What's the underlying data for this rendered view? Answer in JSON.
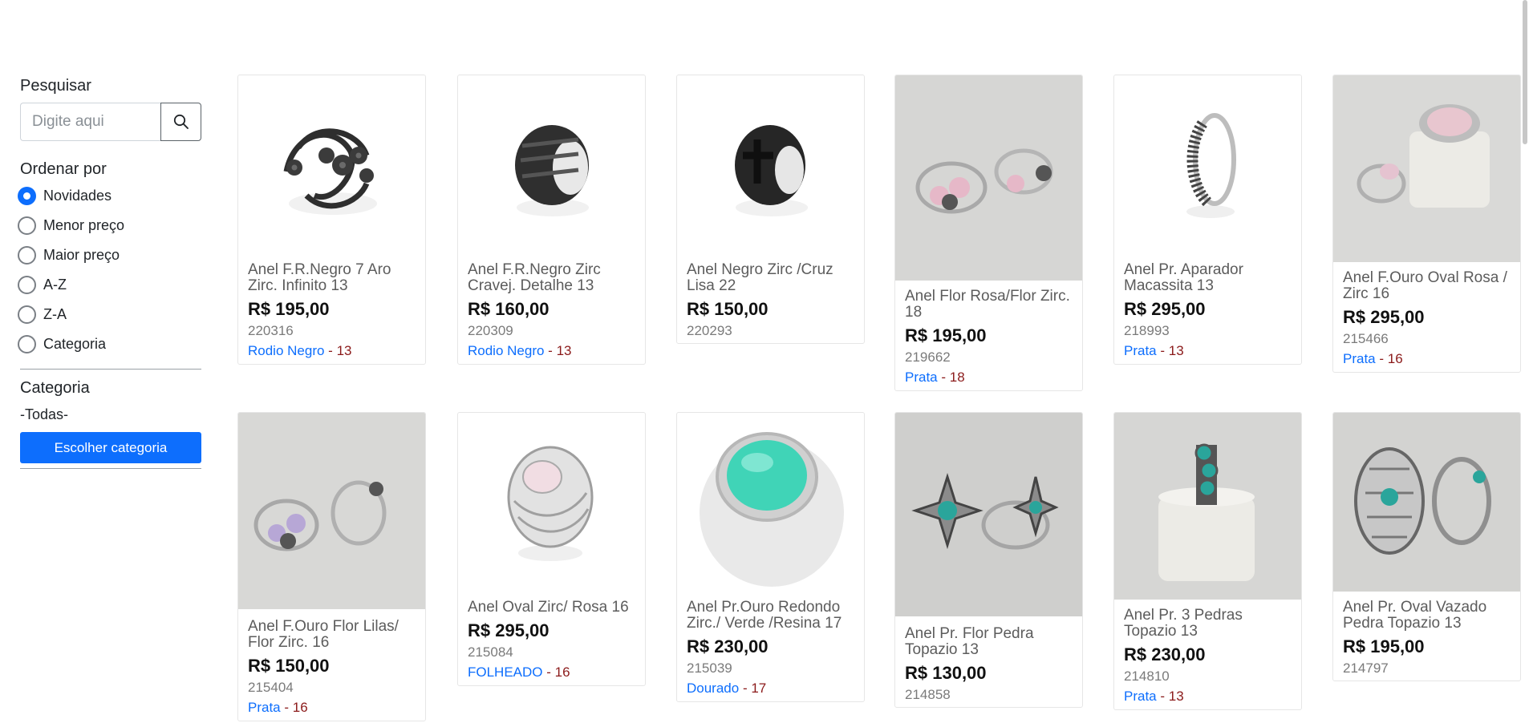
{
  "search": {
    "label": "Pesquisar",
    "placeholder": "Digite aqui"
  },
  "sort": {
    "title": "Ordenar por",
    "options": [
      "Novidades",
      "Menor preço",
      "Maior preço",
      "A-Z",
      "Z-A",
      "Categoria"
    ],
    "selected": "Novidades"
  },
  "category": {
    "title": "Categoria",
    "value": "-Todas-",
    "button_label": "Escolher categoria"
  },
  "colors": {
    "accent": "#0d6efd",
    "size_text": "#8b1a1a"
  },
  "products": [
    {
      "name": "Anel F.R.Negro 7 Aro Zirc. Infinito 13",
      "price": "R$ 195,00",
      "code": "220316",
      "metal": "Rodio Negro",
      "size": "13",
      "image": "black-ring-infinity"
    },
    {
      "name": "Anel F.R.Negro Zirc Cravej. Detalhe 13",
      "price": "R$ 160,00",
      "code": "220309",
      "metal": "Rodio Negro",
      "size": "13",
      "image": "black-ring-band"
    },
    {
      "name": "Anel Negro Zirc /Cruz Lisa 22",
      "price": "R$ 150,00",
      "code": "220293",
      "metal": "",
      "size": "",
      "image": "black-ring-cross"
    },
    {
      "name": "Anel Flor Rosa/Flor Zirc. 18",
      "price": "R$ 195,00",
      "code": "219662",
      "metal": "Prata",
      "size": "18",
      "image": "silver-flower-rings-photo"
    },
    {
      "name": "Anel Pr. Aparador Macassita 13",
      "price": "R$ 295,00",
      "code": "218993",
      "metal": "Prata",
      "size": "13",
      "image": "silver-marcasite-ring"
    },
    {
      "name": "Anel F.Ouro Oval Rosa / Zirc 16",
      "price": "R$ 295,00",
      "code": "215466",
      "metal": "Prata",
      "size": "16",
      "image": "pink-oval-ring-photo"
    },
    {
      "name": "Anel F.Ouro Flor Lilas/ Flor Zirc. 16",
      "price": "R$ 150,00",
      "code": "215404",
      "metal": "Prata",
      "size": "16",
      "image": "lilac-flower-rings-photo"
    },
    {
      "name": "Anel Oval Zirc/ Rosa 16",
      "price": "R$ 295,00",
      "code": "215084",
      "metal": "FOLHEADO",
      "size": "16",
      "image": "silver-oval-pink-ring"
    },
    {
      "name": "Anel Pr.Ouro Redondo Zirc./ Verde /Resina 17",
      "price": "R$ 230,00",
      "code": "215039",
      "metal": "Dourado",
      "size": "17",
      "image": "white-green-resin-ring"
    },
    {
      "name": "Anel Pr. Flor Pedra Topazio 13",
      "price": "R$ 130,00",
      "code": "214858",
      "metal": "",
      "size": "",
      "image": "silver-star-topaz-rings-photo"
    },
    {
      "name": "Anel Pr. 3 Pedras Topazio 13",
      "price": "R$ 230,00",
      "code": "214810",
      "metal": "Prata",
      "size": "13",
      "image": "three-stone-topaz-ring-photo"
    },
    {
      "name": "Anel Pr. Oval Vazado Pedra Topazio 13",
      "price": "R$ 195,00",
      "code": "214797",
      "metal": "",
      "size": "",
      "image": "openwork-topaz-rings-photo"
    }
  ]
}
